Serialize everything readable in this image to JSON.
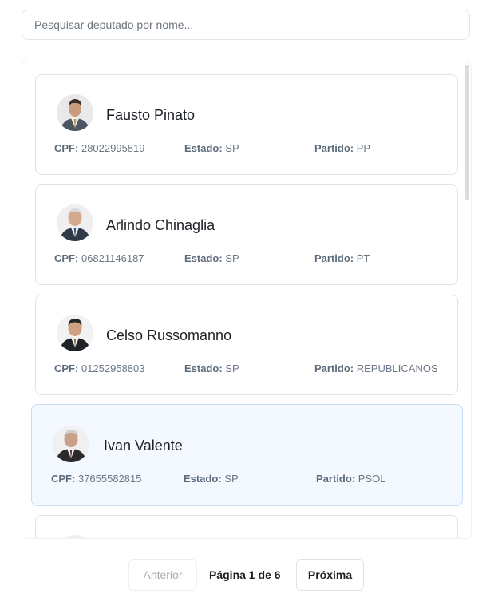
{
  "search": {
    "placeholder": "Pesquisar deputado por nome..."
  },
  "labels": {
    "cpf": "CPF:",
    "estado": "Estado:",
    "partido": "Partido:"
  },
  "deputados": [
    {
      "nome": "Fausto Pinato",
      "cpf": "28022995819",
      "estado": "SP",
      "partido": "PP",
      "selected": false
    },
    {
      "nome": "Arlindo Chinaglia",
      "cpf": "06821146187",
      "estado": "SP",
      "partido": "PT",
      "selected": false
    },
    {
      "nome": "Celso Russomanno",
      "cpf": "01252958803",
      "estado": "SP",
      "partido": "REPUBLICANOS",
      "selected": false
    },
    {
      "nome": "Ivan Valente",
      "cpf": "37655582815",
      "estado": "SP",
      "partido": "PSOL",
      "selected": true
    }
  ],
  "pagination": {
    "prev_label": "Anterior",
    "page_info": "Página 1 de 6",
    "next_label": "Próxima"
  },
  "colors": {
    "selected_bg": "#f4f9ff",
    "border": "#dfe3e7",
    "muted": "#6b7785"
  }
}
